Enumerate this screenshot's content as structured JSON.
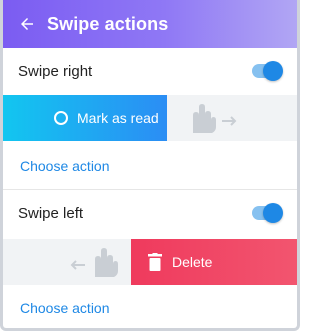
{
  "appbar": {
    "title": "Swipe actions",
    "back_icon": "arrow-left-icon"
  },
  "swipe_right": {
    "label": "Swipe right",
    "enabled": true,
    "action_label": "Mark as read",
    "action_icon": "circle-outline-icon",
    "choose_label": "Choose action"
  },
  "swipe_left": {
    "label": "Swipe left",
    "enabled": true,
    "action_label": "Delete",
    "action_icon": "trash-icon",
    "choose_label": "Choose action"
  },
  "colors": {
    "appbar_start": "#7b5cf2",
    "appbar_end": "#b1a6f4",
    "accent": "#1e88e5",
    "mark_read_start": "#12c6f0",
    "mark_read_end": "#2b8df4",
    "delete": "#ef3a5d"
  }
}
